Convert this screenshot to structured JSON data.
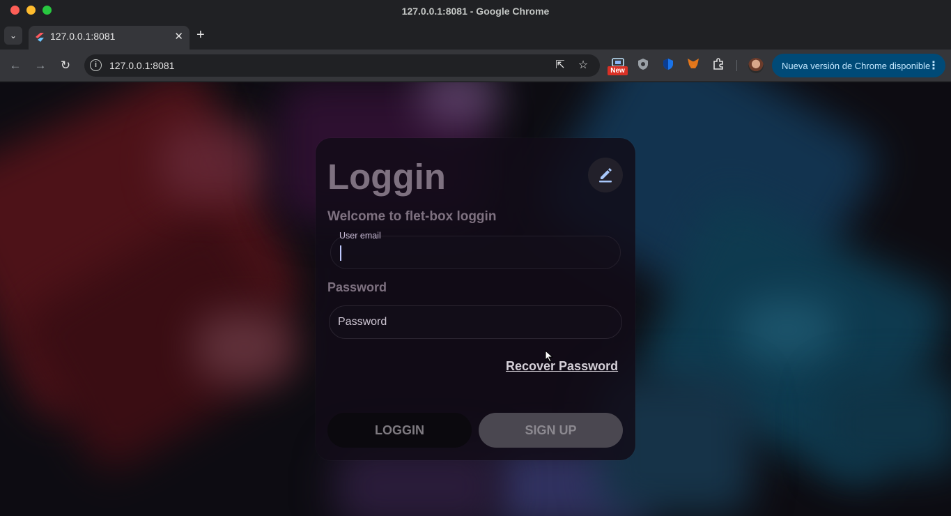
{
  "window": {
    "title": "127.0.0.1:8081 - Google Chrome"
  },
  "tabs": [
    {
      "title": "127.0.0.1:8081",
      "close": "✕"
    }
  ],
  "new_tab": "+",
  "tab_search": "⌄",
  "toolbar": {
    "back": "←",
    "forward": "→",
    "reload": "↻",
    "info_glyph": "i",
    "url": "127.0.0.1:8081",
    "open_in_window": "⇱",
    "bookmark": "☆",
    "extensions": [
      "screen-capture-icon",
      "shield-icon",
      "vpn-shield-icon",
      "metamask-fox-icon",
      "puzzle-extensions-icon"
    ],
    "new_badge": "New",
    "update_label": "Nueva versión de Chrome disponible",
    "menu_dots": "⋮"
  },
  "login": {
    "title": "Loggin",
    "welcome": "Welcome to flet-box loggin",
    "email_label": "User email",
    "email_value": "",
    "password_label": "Password",
    "password_placeholder": "Password",
    "recover": "Recover Password",
    "login_button": "LOGGIN",
    "signup_button": "SIGN UP"
  },
  "colors": {
    "card": "#120c18",
    "title_text": "#7e7180",
    "update_pill": "#004a77",
    "accent_caret": "#bfc9ff"
  }
}
